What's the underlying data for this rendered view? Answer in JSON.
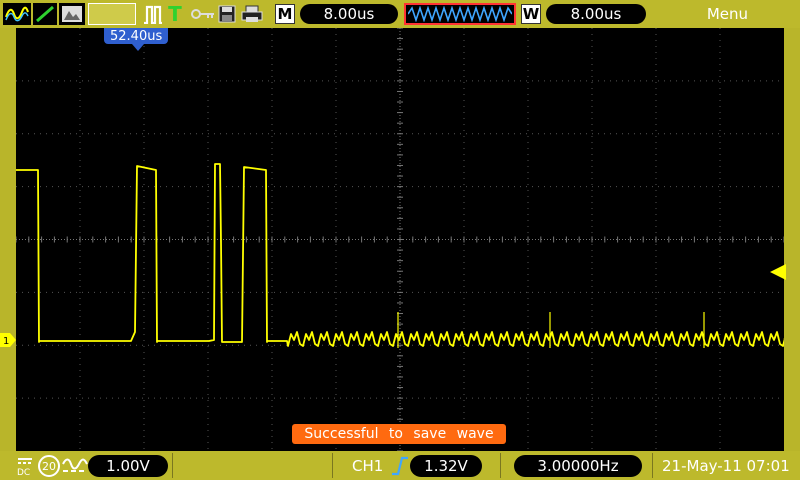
{
  "topbar": {
    "timebase_label": "M",
    "timebase_value": "8.00us",
    "window_label": "W",
    "window_value": "8.00us",
    "menu_label": "Menu",
    "trigger_type_label": "T"
  },
  "screen": {
    "trigger_position": "52.40us",
    "status_message": "Successful to save wave"
  },
  "bottombar": {
    "coupling_label": "DC",
    "bandwidth_label": "20",
    "ch1_scale": "1.00V",
    "trigger_channel": "CH1",
    "trigger_level": "1.32V",
    "frequency": "3.00000Hz",
    "datetime": "21-May-11 07:01"
  },
  "colors": {
    "trace": "#ffff00",
    "frame": "#bdb92c",
    "status_bg": "#ff6a10",
    "trigger_marker": "#2f5fcf"
  },
  "icons": [
    "ch1-waveform-icon",
    "ch2-waveform-icon",
    "photo-icon",
    "run-mode-icon",
    "trigger-icon",
    "key-icon",
    "save-icon",
    "printer-icon",
    "window-waveform-icon"
  ]
}
